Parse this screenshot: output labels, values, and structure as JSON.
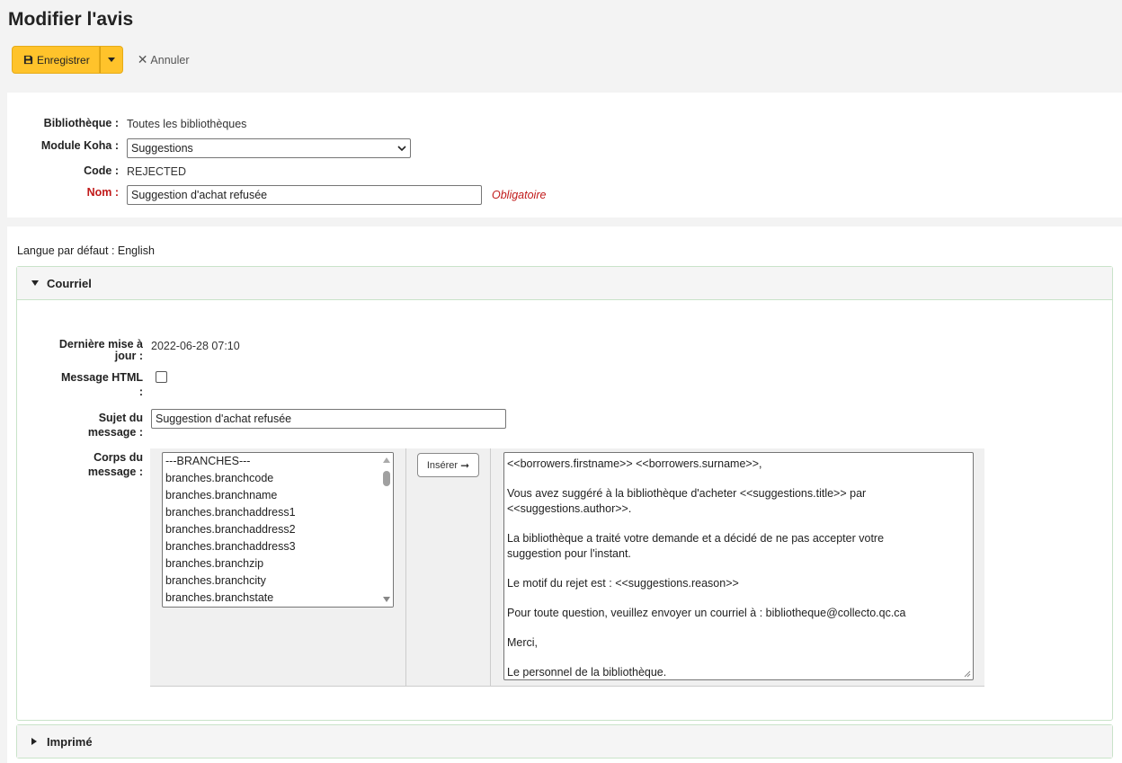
{
  "page": {
    "title": "Modifier l'avis"
  },
  "toolbar": {
    "save_label": "Enregistrer",
    "cancel_label": "Annuler"
  },
  "form": {
    "library_label": "Bibliothèque :",
    "library_value": "Toutes les bibliothèques",
    "module_label": "Module Koha :",
    "module_value": "Suggestions",
    "code_label": "Code :",
    "code_value": "REJECTED",
    "name_label": "Nom :",
    "name_value": "Suggestion d'achat refusée",
    "required_text": "Obligatoire"
  },
  "lang": {
    "default_label": "Langue par défaut : English"
  },
  "sections": {
    "email_title": "Courriel",
    "print_title": "Imprimé"
  },
  "email": {
    "updated_label_1": "Dernière mise à",
    "updated_label_2": "jour :",
    "updated_value": "2022-06-28 07:10",
    "html_label_1": "Message HTML",
    "html_label_2": ":",
    "html_checked": false,
    "subject_label_1": "Sujet du",
    "subject_label_2": "message :",
    "subject_value": "Suggestion d'achat refusée",
    "body_label_1": "Corps du",
    "body_label_2": "message :",
    "insert_label": "Insérer",
    "fields": [
      "---BRANCHES---",
      "branches.branchcode",
      "branches.branchname",
      "branches.branchaddress1",
      "branches.branchaddress2",
      "branches.branchaddress3",
      "branches.branchzip",
      "branches.branchcity",
      "branches.branchstate"
    ],
    "body_lines": [
      " <<borrowers.firstname>> <<borrowers.surname>>,",
      "",
      "Vous avez suggéré à la bibliothèque d'acheter <<suggestions.title>> par",
      "<<suggestions.author>>.",
      "",
      "La bibliothèque a traité votre demande et a décidé de ne pas accepter votre",
      "suggestion pour l'instant.",
      "",
      "Le motif du rejet est : <<suggestions.reason>>",
      "",
      "Pour toute question, veuillez envoyer un courriel à : bibliotheque@collecto.qc.ca",
      "",
      "Merci,",
      "",
      "Le personnel de la bibliothèque."
    ]
  },
  "colors": {
    "primary_button": "#ffc32b",
    "required": "#c11a1a",
    "section_border": "#c9e3c9"
  },
  "icons": {
    "save": "floppy-disk-icon",
    "cancel": "x-icon",
    "insert": "arrow-right-icon"
  }
}
